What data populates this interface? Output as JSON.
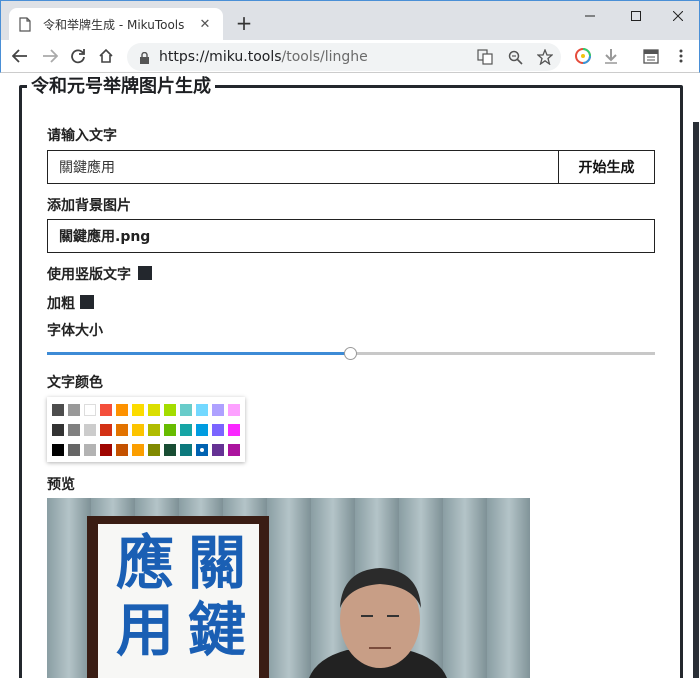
{
  "browser": {
    "tab_title": "令和举牌生成 - MikuTools",
    "url_host": "https://miku.tools",
    "url_path": "/tools/linghe"
  },
  "page": {
    "legend": "令和元号举牌图片生成",
    "text_label": "请输入文字",
    "text_value": "關鍵應用",
    "generate_button": "开始生成",
    "bg_label": "添加背景图片",
    "bg_file": "關鍵應用.png",
    "vertical_label": "使用竖版文字",
    "vertical_checked": true,
    "bold_label": "加粗",
    "bold_checked": true,
    "size_label": "字体大小",
    "font_size_percent": 50,
    "color_label": "文字颜色",
    "preview_label": "预览",
    "palette": [
      [
        "#4d4d4d",
        "#999999",
        "#ffffff",
        "#f44e3b",
        "#fe9200",
        "#fcdc00",
        "#dbdf00",
        "#a4dd00",
        "#68ccca",
        "#73d8ff",
        "#aea1ff",
        "#fda1ff"
      ],
      [
        "#333333",
        "#808080",
        "#cccccc",
        "#d33115",
        "#e27300",
        "#fcc400",
        "#b0bc00",
        "#68bc00",
        "#16a5a5",
        "#009ce0",
        "#7b64ff",
        "#fa28ff"
      ],
      [
        "#000000",
        "#666666",
        "#b3b3b3",
        "#9f0500",
        "#c45100",
        "#fb9e00",
        "#808900",
        "#194d33",
        "#0c797d",
        "#0062b1",
        "#653294",
        "#ab149e"
      ]
    ],
    "selected_color": "#0062b1",
    "preview_chars": [
      "關",
      "鍵",
      "應",
      "用"
    ]
  }
}
